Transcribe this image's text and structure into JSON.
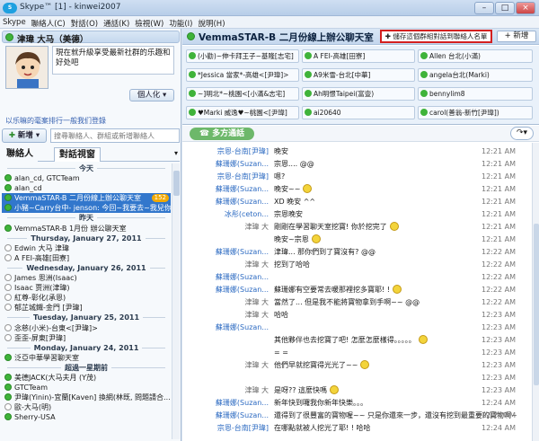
{
  "window": {
    "title": "Skype™ [1] - kinwei2007"
  },
  "menu": [
    "Skype",
    "聯絡人(C)",
    "對話(O)",
    "通話(K)",
    "檢視(W)",
    "功能(I)",
    "說明(H)"
  ],
  "profile": {
    "name": "津瑋  大马（美德）",
    "mood": "現在就升級享受最新社群的乐趣和好处吧",
    "status_button": "個人化",
    "promo_link": "以乐嘛的毫案排行一般我们登錄"
  },
  "search": {
    "new_label": "新增",
    "placeholder": "搜尋聯絡人、群組或新增聯絡人"
  },
  "tabs": [
    "聯絡人",
    "對話視窗"
  ],
  "contacts": [
    {
      "type": "hdr",
      "text": "今天"
    },
    {
      "type": "item",
      "text": "alan_cd, GTCTeam",
      "color": "#3fb33a"
    },
    {
      "type": "item",
      "text": "alan_cd",
      "color": "#3fb33a"
    },
    {
      "type": "item",
      "text": "VemmaSTAR-B 二月份線上辦公聊天室",
      "color": "#3fb33a",
      "selected": true,
      "badge": "152"
    },
    {
      "type": "item",
      "text": "小豬~Carry台中- jenson: 今回~我要去~我兒你",
      "color": "#3fb33a",
      "selected": true
    },
    {
      "type": "hdr",
      "text": "昨天"
    },
    {
      "type": "item",
      "text": "VemmaSTAR-B 1月份 辦公聊天室",
      "color": "#3fb33a"
    },
    {
      "type": "hdr",
      "text": "Thursday, January 27, 2011"
    },
    {
      "type": "item",
      "text": "Edwin 大马 津瑋",
      "color": "#ffffff"
    },
    {
      "type": "item",
      "text": "A FEI-高雄[田寮]",
      "color": "#ffffff"
    },
    {
      "type": "hdr",
      "text": "Wednesday, January 26, 2011"
    },
    {
      "type": "item",
      "text": "James 思洲(Isaac)",
      "color": "#ffffff"
    },
    {
      "type": "item",
      "text": "Isaac 贾洲(津瑋)",
      "color": "#ffffff"
    },
    {
      "type": "item",
      "text": "紅尊-彰化(承恩)",
      "color": "#ffffff"
    },
    {
      "type": "item",
      "text": "郁芷城鐵-金門 [尹瑋]",
      "color": "#ffffff"
    },
    {
      "type": "hdr",
      "text": "Tuesday, January 25, 2011"
    },
    {
      "type": "item",
      "text": "念慈(小米)-台東<[尹瑋]>",
      "color": "#ffffff"
    },
    {
      "type": "item",
      "text": "歪歪-屏東[尹瑋]",
      "color": "#ffffff"
    },
    {
      "type": "hdr",
      "text": "Monday, January 24, 2011"
    },
    {
      "type": "item",
      "text": "泛亞中華學習聊天室",
      "color": "#3fb33a"
    },
    {
      "type": "hdr",
      "text": "超過一星期前"
    },
    {
      "type": "item",
      "text": "美德JACK(大马夫月 (Y茂)",
      "color": "#3fb33a"
    },
    {
      "type": "item",
      "text": "GTCTeam",
      "color": "#3fb33a"
    },
    {
      "type": "item",
      "text": "尹瑋(Yinin)-宜蘭[Kaven] 換網(林既, 問題請合...",
      "color": "#3fb33a"
    },
    {
      "type": "item",
      "text": "歐-大马(明)",
      "color": "#ffffff"
    },
    {
      "type": "item",
      "text": "Sherry-USA",
      "color": "#3fb33a"
    }
  ],
  "chat": {
    "title": "VemmaSTAR-B 二月份線上辦公聊天室",
    "save_label": "儲存這個群組對話到聯絡人名單",
    "add_label": "+ 新增",
    "multichat": "多方通話",
    "participants": [
      "(小勸)~伸卡拜王子~基隆[志宅]",
      "A FEI-高雄[田寮]",
      "Allen 台北(小滿)",
      "*Jessica 當家*-高雄<[尹瑋]>",
      "A9米雪-台北[中華]",
      "angela台北(Marki)",
      "~]明北*~桃園<[小滿&志宅]",
      "Ah明憬Taipei(富壹)",
      "bennylim8",
      "♥Marki 威逸♥~桃園<[尹瑋]",
      "ai20640",
      "carol(善翁-新竹[尹瑋])"
    ],
    "messages": [
      {
        "who": "宗恩-台南[尹瑋]",
        "text": "晚安",
        "time": "12:21 AM"
      },
      {
        "who": "蘇珊娜(Suzan...",
        "text": "宗恩.... @@",
        "time": "12:21 AM"
      },
      {
        "who": "宗恩-台南[尹瑋]",
        "text": "嗯?",
        "time": "12:21 AM"
      },
      {
        "who": "蘇珊娜(Suzan...",
        "text": "晚安~~",
        "time": "12:21 AM",
        "smile": true
      },
      {
        "who": "蘇珊娜(Suzan...",
        "text": "XD 晚安 ^^",
        "time": "12:21 AM"
      },
      {
        "who": "冰彤(ceton...",
        "text": "宗恩晚安",
        "time": "12:21 AM"
      },
      {
        "who": "津瑋 大",
        "text": "剛剛在學習聊天室挖寶! 你於挖完了",
        "time": "12:21 AM",
        "me": true,
        "smile": true
      },
      {
        "who": "",
        "text": "晚安~宗恩",
        "time": "12:21 AM",
        "smile": true
      },
      {
        "who": "蘇珊娜(Suzan...",
        "text": "津瑋... 那你們到了寶沒有? @@",
        "time": "12:22 AM"
      },
      {
        "who": "津瑋 大",
        "text": "挖到了哈哈",
        "time": "12:22 AM",
        "me": true
      },
      {
        "who": "蘇珊娜(Suzan...",
        "text": "",
        "time": "12:22 AM"
      },
      {
        "who": "蘇珊娜(Suzan...",
        "text": "蘇珊娜有空要常去暖那裡挖多寶耶! !",
        "time": "12:22 AM",
        "smile": true
      },
      {
        "who": "津瑋 大",
        "text": "當然了... 但是我不能將寶物拿到手啊~~ @@",
        "time": "12:22 AM",
        "me": true
      },
      {
        "who": "津瑋 大",
        "text": "哈哈",
        "time": "12:23 AM",
        "me": true
      },
      {
        "who": "蘇珊娜(Suzan...",
        "text": "",
        "time": "12:23 AM"
      },
      {
        "who": "",
        "text": "其他夥伴也去挖寶了吧! 怎麼怎麼樣得。。。。。",
        "time": "12:23 AM",
        "smile": true
      },
      {
        "who": "",
        "text": "= =",
        "time": "12:23 AM"
      },
      {
        "who": "津瑋 大",
        "text": "他們早就挖寶得光光了~~",
        "time": "12:23 AM",
        "me": true,
        "smile": true
      },
      {
        "who": "",
        "text": "",
        "time": "12:23 AM"
      },
      {
        "who": "津瑋 大",
        "text": "是呀?? 這麼快嗎",
        "time": "12:23 AM",
        "me": true,
        "smile": true
      },
      {
        "who": "蘇珊娜(Suzan...",
        "text": "新年快到囉我你新年快樂。。。",
        "time": "12:24 AM"
      },
      {
        "who": "蘇珊娜(Suzan...",
        "text": "還得到了很豐富的寶物喔~~ 只是你還來一步，還沒有挖到最重要的寶物啊~~",
        "time": "12:24 AM"
      },
      {
        "who": "宗恩-台南[尹瑋]",
        "text": "在哪點就被人挖光了耶! ! 哈哈",
        "time": "12:24 AM"
      }
    ]
  }
}
